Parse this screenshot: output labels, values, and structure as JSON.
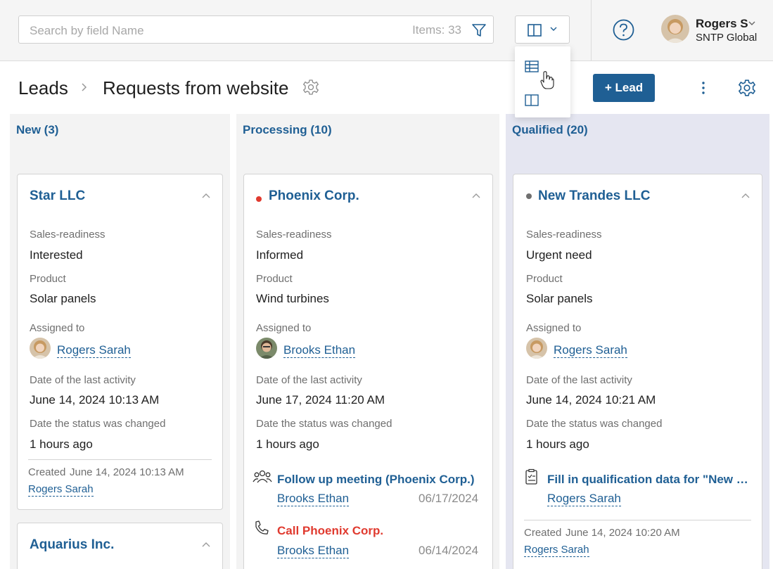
{
  "search": {
    "placeholder": "Search by field Name",
    "count": "Items: 33"
  },
  "user": {
    "name": "Rogers S",
    "org": "SNTP Global"
  },
  "breadcrumb": {
    "root": "Leads",
    "page": "Requests from website"
  },
  "toolbar": {
    "add_label": "+ Lead"
  },
  "colors": {
    "accent": "#1f5f94",
    "red": "#e03a2f"
  },
  "columns": [
    {
      "title": "New (3)",
      "cards": [
        {
          "title": "Star LLC",
          "sales_label": "Sales-readiness",
          "sales": "Interested",
          "product_label": "Product",
          "product": "Solar panels",
          "assigned_label": "Assigned to",
          "assigned": "Rogers Sarah",
          "activity_label": "Date of the last activity",
          "activity": "June 14, 2024 10:13 AM",
          "status_label": "Date the status was changed",
          "status": "1 hours ago",
          "created_label": "Created",
          "created_date": "June 14, 2024 10:13 AM",
          "created_by": "Rogers Sarah"
        },
        {
          "title": "Aquarius Inc."
        }
      ]
    },
    {
      "title": "Processing (10)",
      "cards": [
        {
          "title": "Phoenix Corp.",
          "sales_label": "Sales-readiness",
          "sales": "Informed",
          "product_label": "Product",
          "product": "Wind turbines",
          "assigned_label": "Assigned to",
          "assigned": "Brooks Ethan",
          "activity_label": "Date of the last activity",
          "activity": "June 17, 2024 11:20 AM",
          "status_label": "Date the status was changed",
          "status": "1 hours ago",
          "tasks": [
            {
              "icon": "meeting-icon",
              "title": "Follow up meeting (Phoenix Corp.)",
              "assignee": "Brooks Ethan",
              "date": "06/17/2024"
            },
            {
              "icon": "phone-icon",
              "title": "Call Phoenix Corp.",
              "assignee": "Brooks Ethan",
              "date": "06/14/2024"
            }
          ]
        }
      ]
    },
    {
      "title": "Qualified (20)",
      "cards": [
        {
          "title": "New Trandes LLC",
          "sales_label": "Sales-readiness",
          "sales": "Urgent need",
          "product_label": "Product",
          "product": "Solar panels",
          "assigned_label": "Assigned to",
          "assigned": "Rogers Sarah",
          "activity_label": "Date of the last activity",
          "activity": "June 14, 2024 10:21 AM",
          "status_label": "Date the status was changed",
          "status": "1 hours ago",
          "tasks": [
            {
              "icon": "checklist-icon",
              "title": "Fill in qualification data for \"New Trandes LLC\"",
              "assignee": "Rogers Sarah"
            }
          ],
          "created_label": "Created",
          "created_date": "June 14, 2024 10:20 AM",
          "created_by": "Rogers Sarah"
        }
      ]
    }
  ],
  "view_menu": {
    "items": [
      {
        "icon": "table-view-icon"
      },
      {
        "icon": "kanban-view-icon"
      }
    ]
  }
}
